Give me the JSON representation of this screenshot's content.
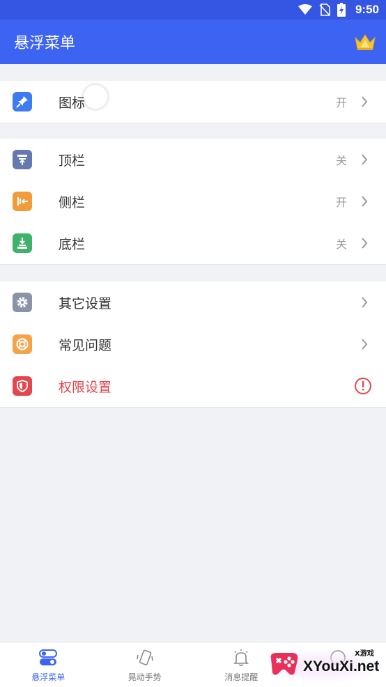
{
  "status_bar": {
    "time": "9:50"
  },
  "app_bar": {
    "title": "悬浮菜单",
    "crown_icon": "crown-icon"
  },
  "groups": [
    {
      "items": [
        {
          "label": "图标",
          "value": "开",
          "icon": "pin-icon",
          "icon_color": "#3d7cf0"
        }
      ]
    },
    {
      "items": [
        {
          "label": "顶栏",
          "value": "关",
          "icon": "top-bar-icon",
          "icon_color": "#6479b0"
        },
        {
          "label": "侧栏",
          "value": "开",
          "icon": "side-bar-icon",
          "icon_color": "#f19b3b"
        },
        {
          "label": "底栏",
          "value": "关",
          "icon": "bottom-bar-icon",
          "icon_color": "#3fb16b"
        }
      ]
    },
    {
      "items": [
        {
          "label": "其它设置",
          "value": "",
          "icon": "gear-icon",
          "icon_color": "#8a93a8"
        },
        {
          "label": "常见问题",
          "value": "",
          "icon": "lifebuoy-icon",
          "icon_color": "#f5a34a"
        },
        {
          "label": "权限设置",
          "value": "",
          "icon": "shield-icon",
          "icon_color": "#e4464e"
        }
      ]
    }
  ],
  "colors": {
    "primary": "#3d63f3",
    "danger": "#e4464e"
  },
  "bottom_nav": [
    {
      "label": "悬浮菜单",
      "icon": "toggle-icon",
      "active": true
    },
    {
      "label": "晃动手势",
      "icon": "shake-phone-icon",
      "active": false
    },
    {
      "label": "消息提醒",
      "icon": "bell-icon",
      "active": false
    },
    {
      "label": "",
      "icon": "more-icon",
      "active": false
    }
  ],
  "watermark": {
    "text": "XYouXi.net",
    "sub": "X游戏"
  }
}
